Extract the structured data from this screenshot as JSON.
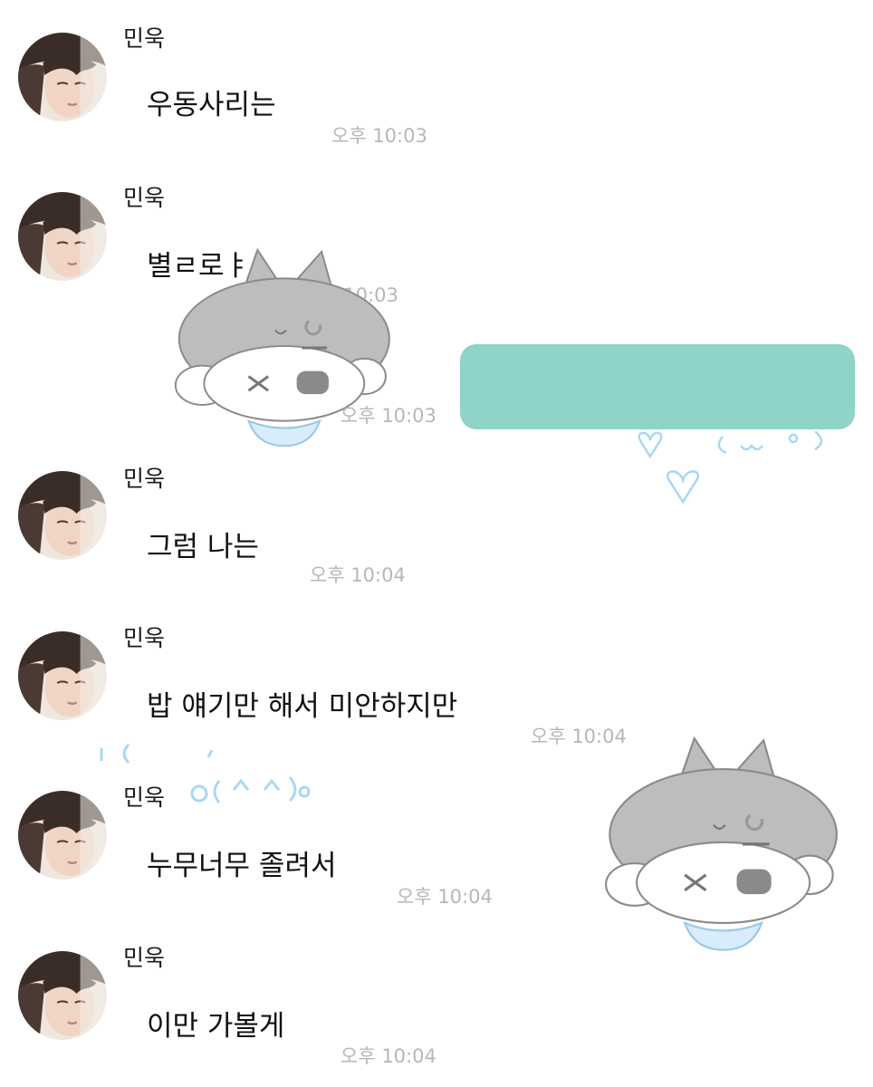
{
  "colors": {
    "background": "#ffffff",
    "teal_bubble": "#90d3c8",
    "timestamp": "#b7b7b7",
    "doodle_blue": "#a9d8f2",
    "cat_gray": "#b9b9b9"
  },
  "messages": [
    {
      "sender": "민욱",
      "text": "우동사리는",
      "time": "오후 10:03"
    },
    {
      "sender": "민욱",
      "text": "별ㄹ로ㅑ",
      "time": "오후 10:03"
    },
    {
      "sender": "민욱",
      "text": "그럼 나는",
      "time": "오후 10:04"
    },
    {
      "sender": "민욱",
      "text": "밥 얘기만 해서 미안하지만",
      "time": "오후 10:04"
    },
    {
      "sender": "민욱",
      "text": "누무너무 졸려서",
      "time": "오후 10:04"
    },
    {
      "sender": "민욱",
      "text": "이만 가볼게",
      "time": "오후 10:04"
    }
  ],
  "sticker_time": "오후 10:03",
  "icons": {
    "avatar": "profile-photo",
    "sticker_small": "gray-cat-sticker",
    "sticker_large": "gray-cat-sticker",
    "doodle_hearts": "heart-doodle",
    "doodle_face": "smile-doodle"
  }
}
